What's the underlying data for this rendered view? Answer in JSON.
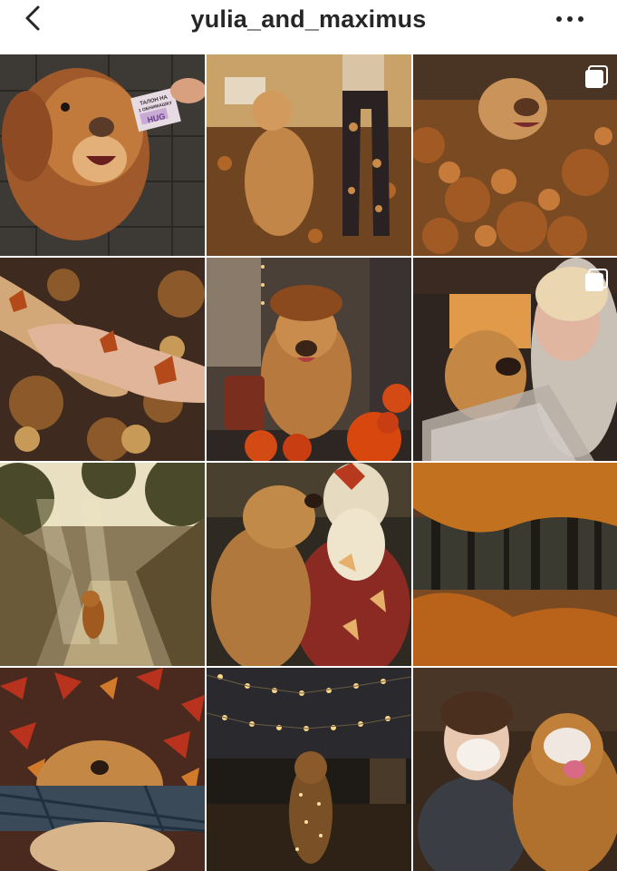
{
  "header": {
    "username": "yulia_and_maximus",
    "back_icon": "chevron-left-icon",
    "more_icon": "more-horizontal-icon"
  },
  "photo_sign": {
    "line1": "ТАЛОН НА",
    "line2": "1 ОБНИМАШКУ",
    "line3": "HUG"
  },
  "colors": {
    "header_bg": "#ffffff",
    "text": "#262626",
    "grid_gap": "#ffffff"
  },
  "posts": [
    {
      "name": "post-dog-with-coupon",
      "multi": false
    },
    {
      "name": "post-dog-jumping-leaves",
      "multi": false
    },
    {
      "name": "post-dog-in-leaf-pile",
      "multi": true
    },
    {
      "name": "post-paw-and-hand",
      "multi": false
    },
    {
      "name": "post-dog-with-pumpkins",
      "multi": false
    },
    {
      "name": "post-dog-and-woman",
      "multi": true
    },
    {
      "name": "post-dog-on-sunny-path",
      "multi": false
    },
    {
      "name": "post-dog-kissing-woman",
      "multi": false
    },
    {
      "name": "post-forest-through-leaf",
      "multi": false
    },
    {
      "name": "post-dog-in-red-leaves",
      "multi": false
    },
    {
      "name": "post-dog-with-lights",
      "multi": false
    },
    {
      "name": "post-boy-and-dog-cake",
      "multi": false
    }
  ]
}
